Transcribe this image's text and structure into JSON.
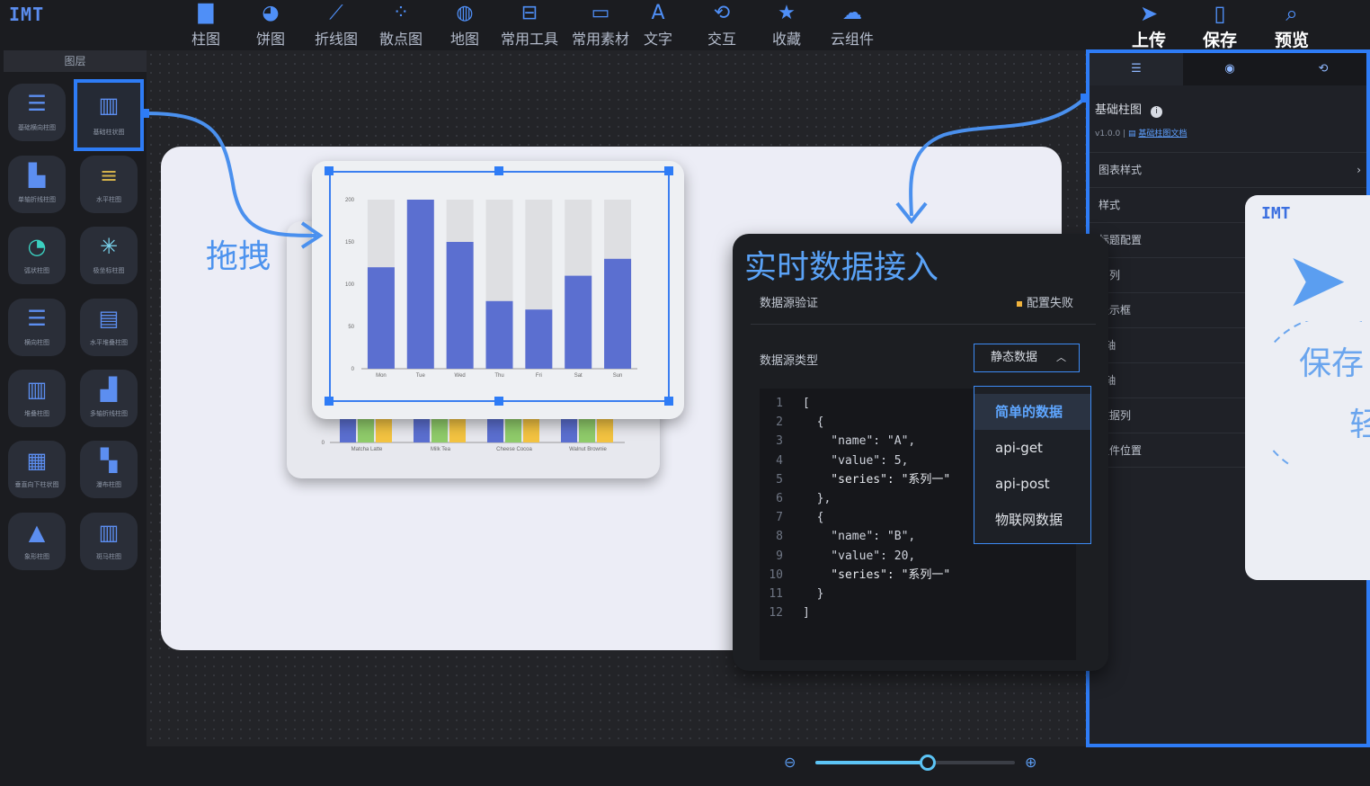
{
  "app": {
    "logo_text": "IMT"
  },
  "toolbar": {
    "items": [
      {
        "label": "柱图",
        "icon": "bar-chart-icon"
      },
      {
        "label": "饼图",
        "icon": "pie-chart-icon"
      },
      {
        "label": "折线图",
        "icon": "line-chart-icon"
      },
      {
        "label": "散点图",
        "icon": "scatter-icon"
      },
      {
        "label": "地图",
        "icon": "globe-icon"
      },
      {
        "label": "常用工具",
        "icon": "toolbox-icon"
      },
      {
        "label": "常用素材",
        "icon": "folder-icon"
      },
      {
        "label": "文字",
        "icon": "text-icon"
      },
      {
        "label": "交互",
        "icon": "interaction-icon"
      },
      {
        "label": "收藏",
        "icon": "star-icon"
      },
      {
        "label": "云组件",
        "icon": "cloud-icon"
      }
    ],
    "actions": [
      {
        "label": "上传",
        "icon": "send-icon"
      },
      {
        "label": "保存",
        "icon": "save-icon"
      },
      {
        "label": "预览",
        "icon": "preview-icon"
      }
    ]
  },
  "sidebar": {
    "title": "图层",
    "components": [
      {
        "label": "基础横向柱图"
      },
      {
        "label": "基础柱状图"
      },
      {
        "label": "单轴折线柱图"
      },
      {
        "label": "水平柱图"
      },
      {
        "label": "弧状柱图"
      },
      {
        "label": "极坐标柱图"
      },
      {
        "label": "横向柱图"
      },
      {
        "label": "水平堆叠柱图"
      },
      {
        "label": "堆叠柱图"
      },
      {
        "label": "多轴折线柱图"
      },
      {
        "label": "垂直向下柱状图"
      },
      {
        "label": "瀑布柱图"
      },
      {
        "label": "象形柱图"
      },
      {
        "label": "斑马柱图"
      }
    ]
  },
  "canvas": {
    "drag_label": "拖拽"
  },
  "chart_data": [
    {
      "type": "bar",
      "categories": [
        "Mon",
        "Tue",
        "Wed",
        "Thu",
        "Fri",
        "Sat",
        "Sun"
      ],
      "values": [
        120,
        200,
        150,
        80,
        70,
        110,
        130
      ],
      "background_max": 200,
      "ylim": [
        0,
        200
      ],
      "yticks": [
        0,
        50,
        100,
        150,
        200
      ],
      "color": "#5b6fd0",
      "background_color": "#dedfe2"
    },
    {
      "type": "bar",
      "categories": [
        "Matcha Latte",
        "Milk Tea",
        "Cheese Cocoa",
        "Walnut Brownie"
      ],
      "yticks": [
        0
      ],
      "series_colors": [
        "#5b6fd0",
        "#8fcb6a",
        "#f3c341"
      ]
    }
  ],
  "right_panel": {
    "tabs": [
      "settings-icon",
      "database-icon",
      "interaction-icon"
    ],
    "title": "基础柱图",
    "version": "v1.0.0 |",
    "doc_link": "基础柱图文档",
    "rows": [
      "图表样式",
      "样式",
      "标题配置",
      "系列",
      "提示框",
      "x轴",
      "y轴",
      "数据列",
      "组件位置"
    ]
  },
  "share_card": {
    "logo": "IMT",
    "text": "保存",
    "text2": "轻"
  },
  "data_panel": {
    "title": "实时数据接入",
    "verify_label": "数据源验证",
    "verify_status": "配置失败",
    "type_label": "数据源类型",
    "type_value": "静态数据",
    "options": [
      "简单的数据",
      "api-get",
      "api-post",
      "物联网数据"
    ],
    "code_lines": [
      "[",
      "  {",
      "    \"name\": \"A\",",
      "    \"value\": 5,",
      "    \"series\": \"系列一\"",
      "  },",
      "  {",
      "    \"name\": \"B\",",
      "    \"value\": 20,",
      "    \"series\": \"系列一\"",
      "  }",
      "]"
    ]
  },
  "colors": {
    "accent": "#2e7cf6",
    "warning": "#f0b33d"
  }
}
